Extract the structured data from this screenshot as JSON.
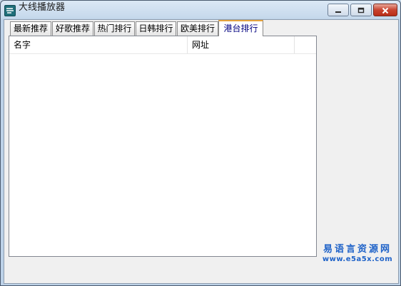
{
  "window": {
    "title": "大线播放器",
    "app_icon": "app-logo-icon",
    "controls": {
      "minimize": "minimize-icon",
      "maximize": "maximize-icon",
      "close": "close-icon"
    }
  },
  "tabs": [
    {
      "label": "最新推荐",
      "active": false
    },
    {
      "label": "好歌推荐",
      "active": false
    },
    {
      "label": "热门排行",
      "active": false
    },
    {
      "label": "日韩排行",
      "active": false
    },
    {
      "label": "欧美排行",
      "active": false
    },
    {
      "label": "港台排行",
      "active": true
    }
  ],
  "list": {
    "columns": [
      "名字",
      "网址"
    ],
    "rows": []
  },
  "watermark": {
    "name": "易语言资源网",
    "url": "www.e5a5x.com"
  },
  "colors": {
    "active_tab_accent": "#e6a33c",
    "active_tab_text": "#000080",
    "watermark": "#1e62c8",
    "close_button": "#c8432f"
  }
}
